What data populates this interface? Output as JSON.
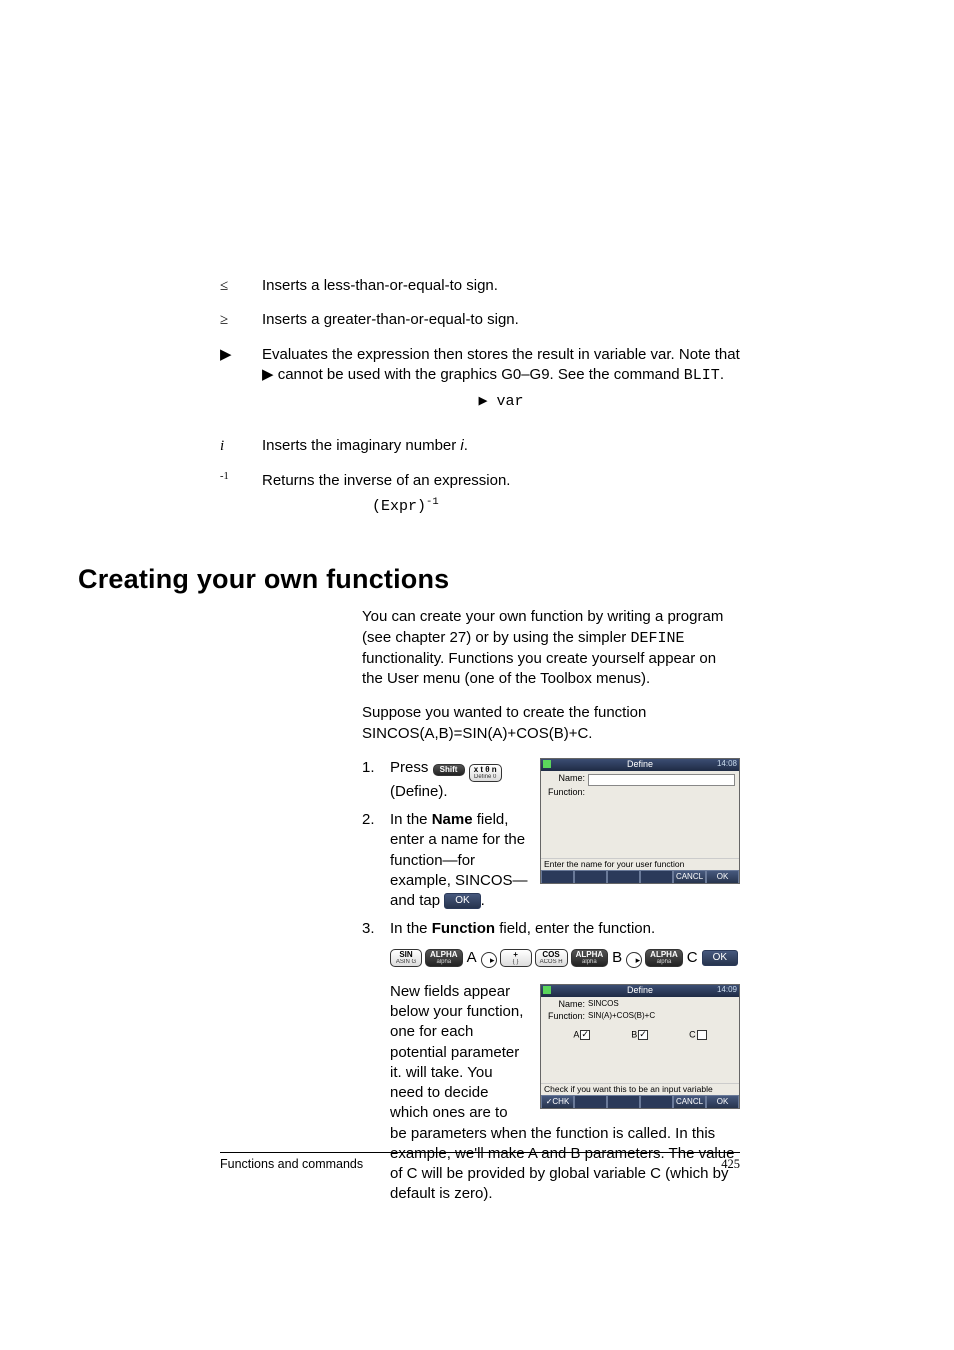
{
  "symbols": {
    "le": {
      "glyph": "≤",
      "desc": "Inserts a less-than-or-equal-to sign."
    },
    "ge": {
      "glyph": "≥",
      "desc": "Inserts a greater-than-or-equal-to sign."
    },
    "sto": {
      "glyph": "▶",
      "desc_a": "Evaluates the expression then stores the result in variable var. Note that ",
      "desc_b": " cannot be used with the graphics G0–G9. See the command ",
      "blit": "BLIT",
      "period": ".",
      "example": "▶ var"
    },
    "i": {
      "glyph": "i",
      "desc_a": "Inserts the imaginary number ",
      "desc_b": ".",
      "i": "i"
    },
    "inv": {
      "glyph": "-1",
      "desc": "Returns the inverse of an expression.",
      "example_a": "(Expr)",
      "example_b": "-1"
    }
  },
  "section_title": "Creating your own functions",
  "intro_a": "You can create your own function by writing a program (see chapter 27) or by using the simpler ",
  "intro_define": "DEFINE",
  "intro_b": " functionality. Functions you create yourself appear on the User menu (one of the Toolbox menus).",
  "suppose": "Suppose you wanted to create the function SINCOS(A,B)=SIN(A)+COS(B)+C.",
  "steps": {
    "s1_a": "Press ",
    "s1_shift_top": "Shift",
    "s1_def_top": "x t θ n",
    "s1_def_bot": "Define   0",
    "s1_b": " (Define).",
    "s2_a": "In the ",
    "s2_name": "Name",
    "s2_b": " field, enter a name for the function—for example, SINCOS—and tap ",
    "s2_c": ".",
    "ok_label": "OK",
    "s3_a": "In the ",
    "s3_func": "Function",
    "s3_b": " field, enter the function."
  },
  "keyrow": {
    "sin_top": "SIN",
    "sin_bot": "ASIN   G",
    "alpha_top": "ALPHA",
    "alpha_bot": "alpha",
    "A": "A",
    "plus_top": "+",
    "plus_bot": "{ }",
    "cos_top": "COS",
    "cos_bot": "ACOS   H",
    "B": "B",
    "C": "C",
    "ok": "OK"
  },
  "para_after": "New fields appear below your function, one for each potential parameter it. will take. You need to decide which ones are to be parameters when the function is called. In this example, we'll make A and B parameters. The value of C will be provided by global variable C (which by default is zero).",
  "shot1": {
    "title": "Define",
    "time": "14:08",
    "name_lbl": "Name:",
    "name_val": "",
    "func_lbl": "Function:",
    "hint": "Enter the name for your user function",
    "menu_cancel": "CANCL",
    "menu_ok": "OK"
  },
  "shot2": {
    "title": "Define",
    "time": "14:09",
    "name_lbl": "Name:",
    "name_val": "SINCOS",
    "func_lbl": "Function:",
    "func_val": "SIN(A)+COS(B)+C",
    "a": "A",
    "b": "B",
    "c": "C",
    "hint": "Check if you want this to be an input variable",
    "menu_chk": "✓CHK",
    "menu_cancel": "CANCL",
    "menu_ok": "OK"
  },
  "footer": {
    "left": "Functions and commands",
    "right": "425"
  }
}
